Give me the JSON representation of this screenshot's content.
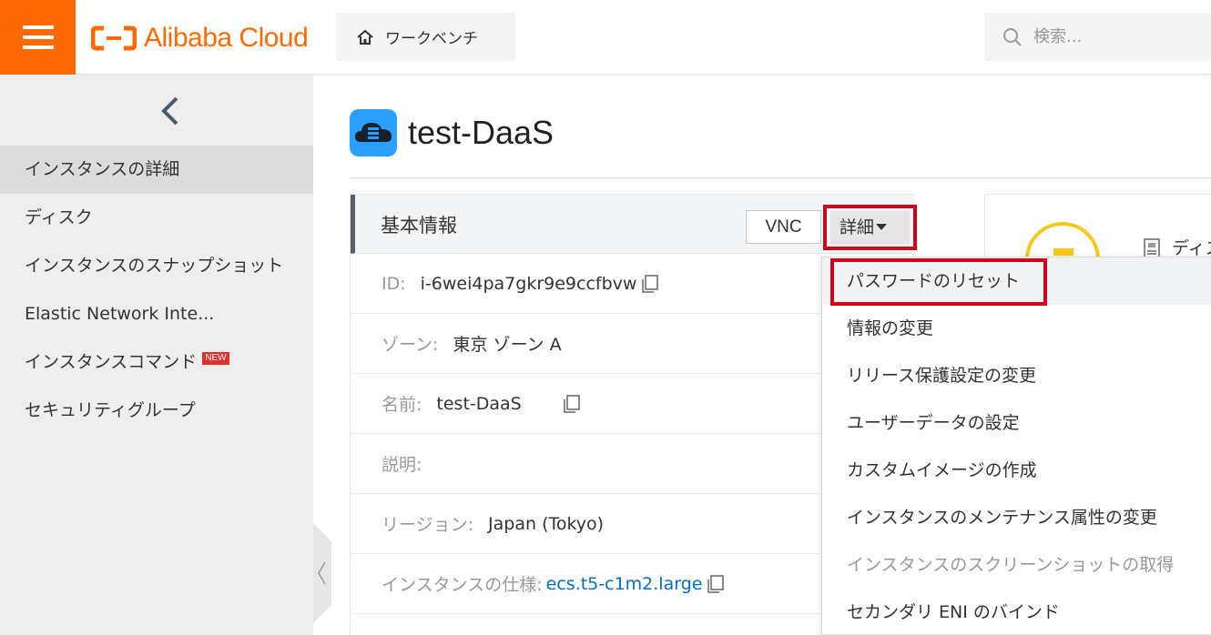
{
  "header": {
    "brand": "Alibaba Cloud",
    "workbench_label": "ワークベンチ",
    "search_placeholder": "検索...",
    "brand_color": "#ff6a00"
  },
  "sidebar": {
    "items": [
      {
        "label": "インスタンスの詳細",
        "active": true
      },
      {
        "label": "ディスク"
      },
      {
        "label": "インスタンスのスナップショット"
      },
      {
        "label": "Elastic Network Inte..."
      },
      {
        "label": "インスタンスコマンド",
        "badge": "NEW"
      },
      {
        "label": "セキュリティグループ"
      }
    ]
  },
  "page": {
    "title": "test-DaaS"
  },
  "basic_info": {
    "title": "基本情報",
    "vnc_label": "VNC",
    "detail_label": "詳細",
    "rows": [
      {
        "key": "ID:",
        "value": "i-6wei4pa7gkr9e9ccfbvw"
      },
      {
        "key": "ゾーン:",
        "value": "東京 ゾーン A"
      },
      {
        "key": "名前:",
        "value": "test-DaaS"
      },
      {
        "key": "説明:",
        "value": ""
      },
      {
        "key": "リージョン:",
        "value": "Japan (Tokyo)"
      },
      {
        "key": "インスタンスの仕様:",
        "value": "ecs.t5-c1m2.large"
      }
    ]
  },
  "right_card": {
    "label": "ディス"
  },
  "detail_menu": {
    "items": [
      {
        "label": "パスワードのリセット",
        "highlighted": true
      },
      {
        "label": "情報の変更"
      },
      {
        "label": "リリース保護設定の変更"
      },
      {
        "label": "ユーザーデータの設定"
      },
      {
        "label": "カスタムイメージの作成"
      },
      {
        "label": "インスタンスのメンテナンス属性の変更"
      },
      {
        "label": "インスタンスのスクリーンショットの取得",
        "disabled": true
      },
      {
        "label": "セカンダリ ENI のバインド"
      }
    ]
  },
  "colors": {
    "highlight_red": "#d0021b",
    "link_blue": "#0070cc",
    "status_yellow": "#f8c81c"
  }
}
